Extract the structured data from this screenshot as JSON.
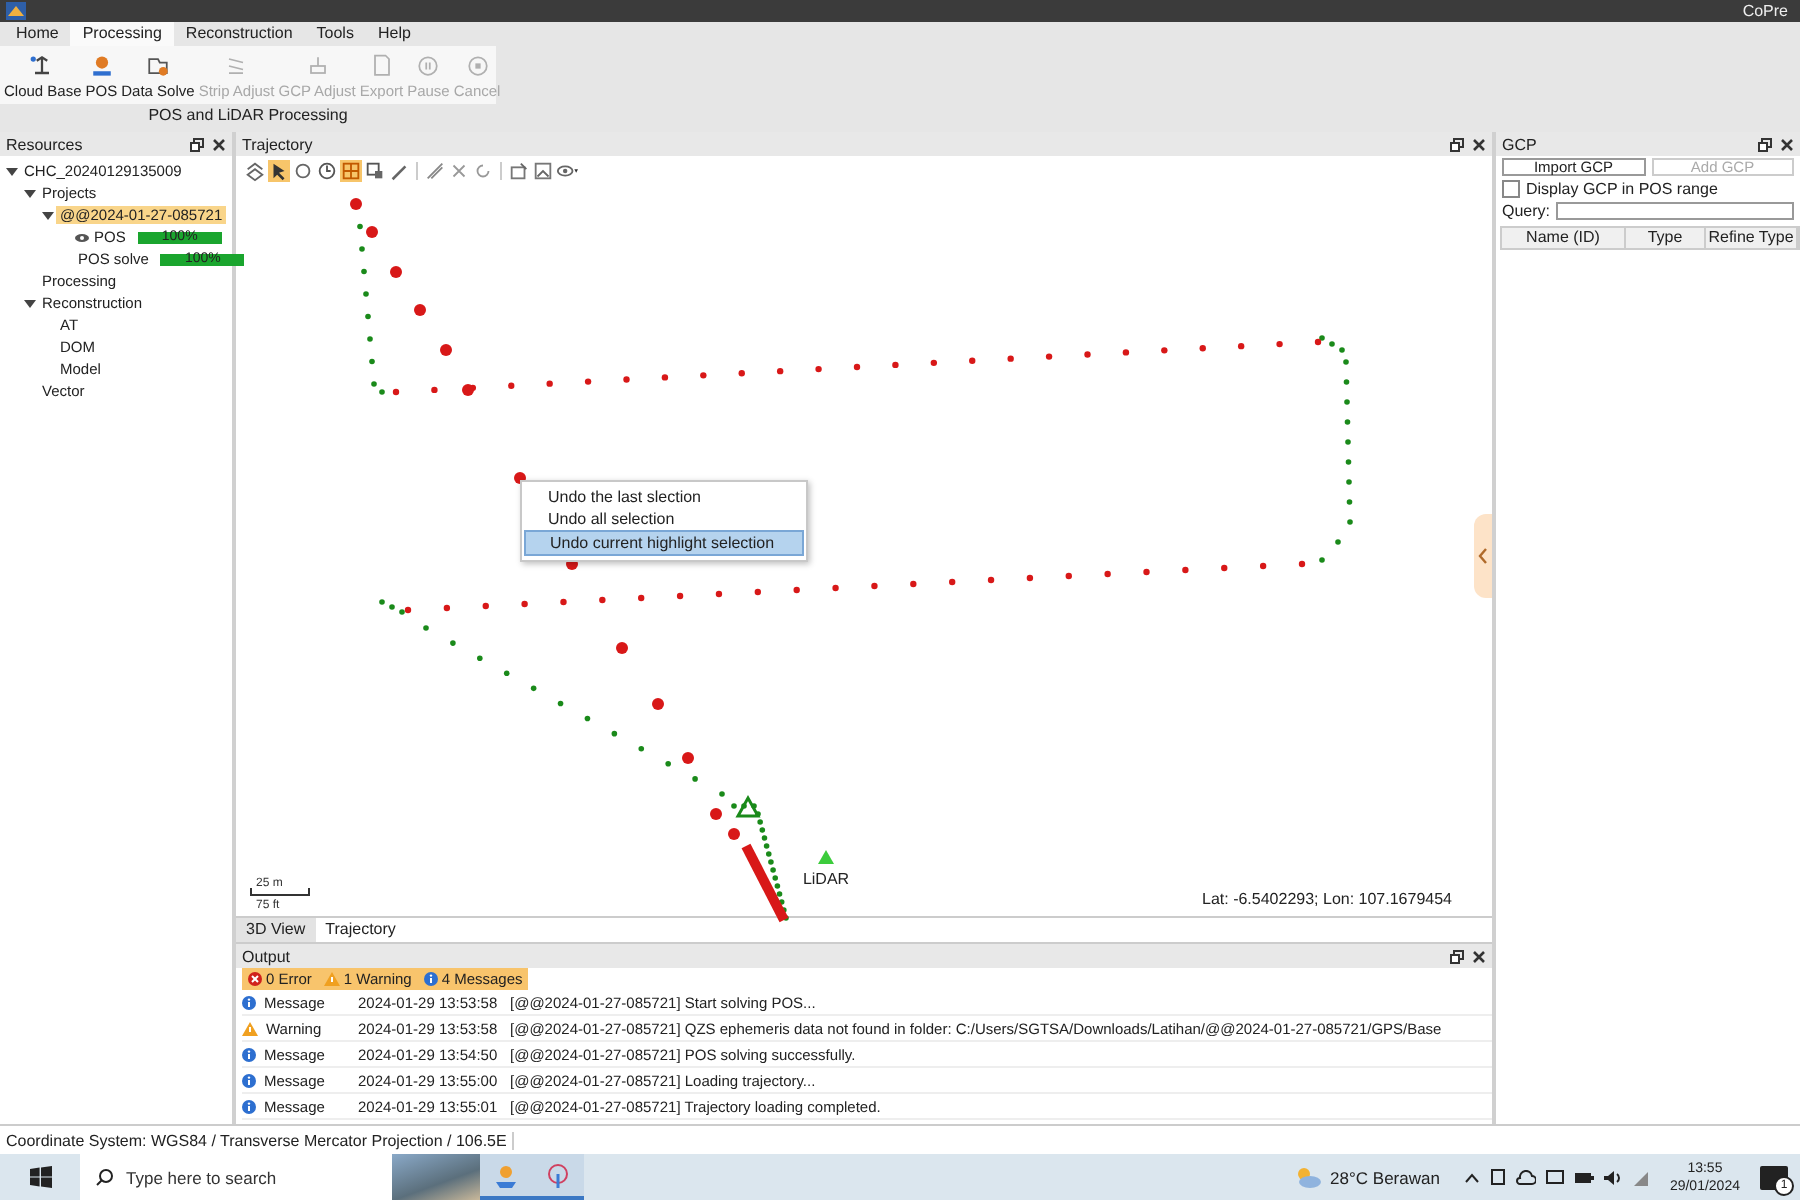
{
  "window": {
    "title": "CoPre"
  },
  "menu_tabs": [
    {
      "label": "Home",
      "selected": false
    },
    {
      "label": "Processing",
      "selected": true
    },
    {
      "label": "Reconstruction",
      "selected": false
    },
    {
      "label": "Tools",
      "selected": false
    },
    {
      "label": "Help",
      "selected": false
    }
  ],
  "ribbon": {
    "buttons": [
      {
        "label": "Cloud Base",
        "disabled": false
      },
      {
        "label": "POS",
        "disabled": false
      },
      {
        "label": "Data Solve",
        "disabled": false
      },
      {
        "label": "Strip Adjust",
        "disabled": true
      },
      {
        "label": "GCP Adjust",
        "disabled": true
      },
      {
        "label": "Export",
        "disabled": true
      },
      {
        "label": "Pause",
        "disabled": true
      },
      {
        "label": "Cancel",
        "disabled": true
      }
    ],
    "group_label": "POS and LiDAR Processing"
  },
  "resources_panel": {
    "title": "Resources",
    "tree": [
      {
        "label": "CHC_20240129135009",
        "selected": false,
        "expanded": true,
        "children": [
          {
            "label": "Projects",
            "selected": false,
            "expanded": true,
            "children": [
              {
                "label": "@@2024-01-27-085721",
                "selected": true,
                "expanded": true,
                "children": [
                  {
                    "label": "POS",
                    "kind": "layer",
                    "selected": false,
                    "progress": {
                      "level": 1,
                      "text": "100%"
                    }
                  },
                  {
                    "label": "POS solve",
                    "kind": "task",
                    "selected": false,
                    "progress": {
                      "level": 1,
                      "text": "100%"
                    }
                  }
                ]
              }
            ]
          },
          {
            "label": "Processing",
            "selected": false
          },
          {
            "label": "Reconstruction",
            "selected": false,
            "expanded": true,
            "children": [
              {
                "label": "AT",
                "selected": false
              },
              {
                "label": "DOM",
                "selected": false
              },
              {
                "label": "Model",
                "selected": false
              }
            ]
          },
          {
            "label": "Vector",
            "selected": false
          }
        ]
      }
    ]
  },
  "trajectory_panel": {
    "title": "Trajectory",
    "tools": [
      {
        "selected": false
      },
      {
        "selected": true
      },
      {
        "selected": false
      },
      {
        "selected": false
      },
      {
        "selected": true
      },
      {
        "selected": false
      },
      {
        "selected": false
      },
      {
        "selected": false
      },
      {
        "selected": false
      },
      {
        "selected": false
      },
      {
        "selected": false
      },
      {
        "selected": false
      },
      {
        "selected": false
      }
    ],
    "map": {
      "marker_label": "LiDAR",
      "scale_m": "25 m",
      "scale_ft": "75 ft",
      "coordinates": "Lat: -6.5402293; Lon: 107.1679454"
    },
    "context_menu": [
      {
        "label": "Undo the last slection",
        "selected": false
      },
      {
        "label": "Undo all selection",
        "selected": false
      },
      {
        "label": "Undo current highlight selection",
        "selected": true
      }
    ],
    "view_tabs": [
      {
        "label": "3D View",
        "selected": false
      },
      {
        "label": "Trajectory",
        "selected": true
      }
    ]
  },
  "output": {
    "title": "Output",
    "filters": [
      {
        "kind": "error",
        "label": "0 Error",
        "on": true
      },
      {
        "kind": "warning",
        "label": "1 Warning",
        "on": true
      },
      {
        "kind": "info",
        "label": "4 Messages",
        "on": true
      }
    ],
    "rows": [
      {
        "kind": "info",
        "type": "Message",
        "time": "2024-01-29 13:53:58",
        "text": "[@@2024-01-27-085721] Start solving POS..."
      },
      {
        "kind": "warning",
        "type": "Warning",
        "time": "2024-01-29 13:53:58",
        "text": "[@@2024-01-27-085721] QZS ephemeris data not found in folder: C:/Users/SGTSA/Downloads/Latihan/@@2024-01-27-085721/GPS/Base"
      },
      {
        "kind": "info",
        "type": "Message",
        "time": "2024-01-29 13:54:50",
        "text": "[@@2024-01-27-085721] POS solving successfully."
      },
      {
        "kind": "info",
        "type": "Message",
        "time": "2024-01-29 13:55:00",
        "text": "[@@2024-01-27-085721] Loading trajectory..."
      },
      {
        "kind": "info",
        "type": "Message",
        "time": "2024-01-29 13:55:01",
        "text": "[@@2024-01-27-085721] Trajectory loading completed."
      }
    ]
  },
  "gcp_panel": {
    "title": "GCP",
    "buttons": [
      {
        "label": "Import GCP",
        "disabled": false
      },
      {
        "label": "Add GCP",
        "disabled": true
      }
    ],
    "display_in_range": {
      "label": "Display GCP in POS range",
      "checked": false
    },
    "query_label": "Query:",
    "columns": [
      "Name (ID)",
      "Type",
      "Refine Type"
    ]
  },
  "status_bar": "Coordinate System: WGS84 / Transverse Mercator Projection / 106.5E",
  "taskbar": {
    "search_placeholder": "Type here to search",
    "weather": "28°C Berawan",
    "time": "13:55",
    "date": "29/01/2024",
    "notification_count": "1"
  }
}
